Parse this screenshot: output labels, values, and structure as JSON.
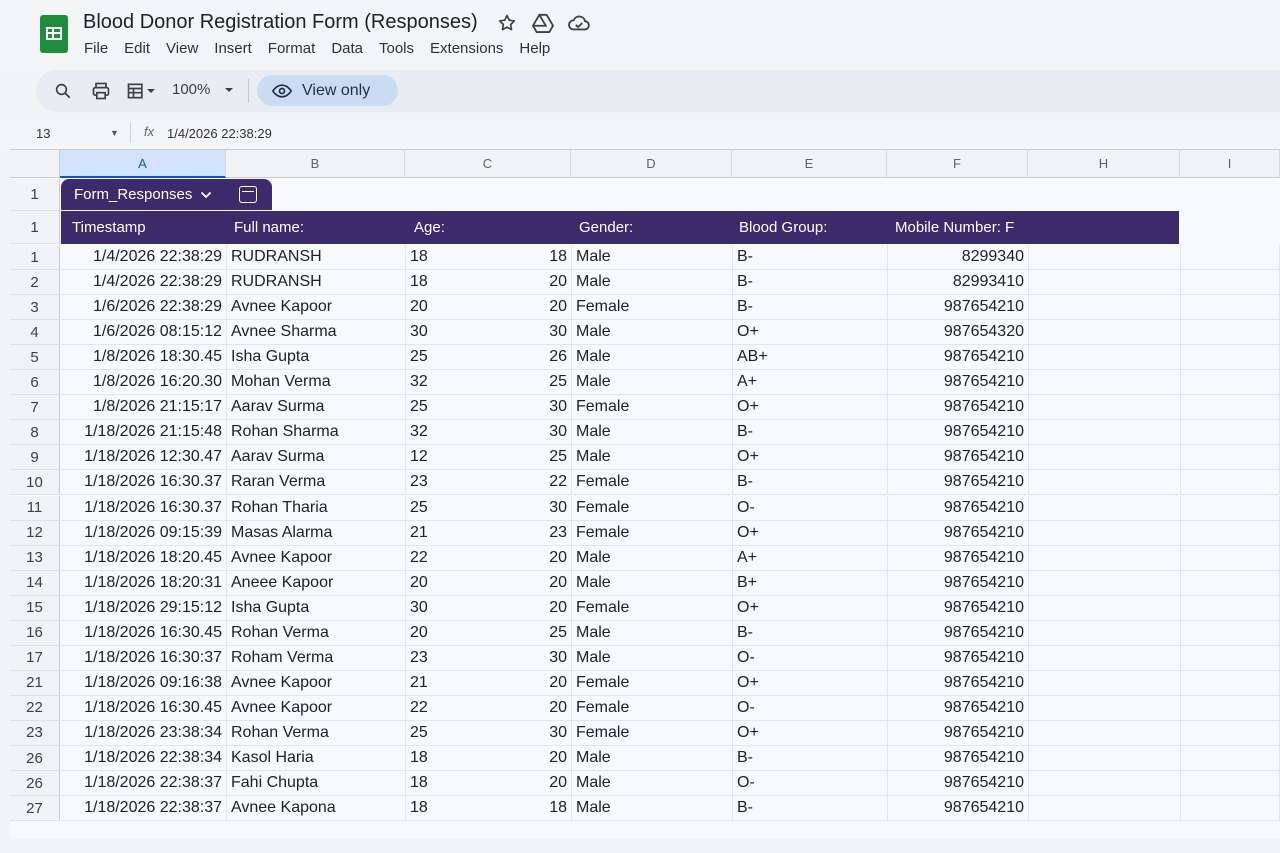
{
  "app": {
    "title": "Blood Donor Registration Form (Responses)",
    "menu": [
      "File",
      "Edit",
      "View",
      "Insert",
      "Format",
      "Data",
      "Tools",
      "Extensions",
      "Help"
    ],
    "icons": [
      "star-icon",
      "move-to-drive-icon",
      "cloud-status-icon"
    ]
  },
  "toolbar": {
    "zoom": "100%",
    "view_only_label": "View only"
  },
  "formula_bar": {
    "cell_ref": "13",
    "fx_symbol": "fx",
    "value": "1/4/2026 22:38:29"
  },
  "grid": {
    "columns": [
      "A",
      "B",
      "C",
      "D",
      "E",
      "F",
      "H",
      "I"
    ],
    "table_tab": {
      "label": "Form_Responses",
      "row_number": "1"
    },
    "header_row_number": "1",
    "headers": [
      "Timestamp",
      "Full name:",
      "Age:",
      "Gender:",
      "Blood Group:",
      "Mobile Number: F"
    ],
    "rows": [
      {
        "n": "1",
        "ts": "1/4/2026 22:38:29",
        "name": "RUDRANSH",
        "age_a": "18",
        "age_b": "18",
        "gender": "Male",
        "blood": "B-",
        "mobile": "8299340"
      },
      {
        "n": "2",
        "ts": "1/4/2026 22:38:29",
        "name": "RUDRANSH",
        "age_a": "18",
        "age_b": "20",
        "gender": "Male",
        "blood": "B-",
        "mobile": "82993410"
      },
      {
        "n": "3",
        "ts": "1/6/2026 22:38:29",
        "name": "Avnee Kapoor",
        "age_a": "20",
        "age_b": "20",
        "gender": "Female",
        "blood": "B-",
        "mobile": "987654210"
      },
      {
        "n": "4",
        "ts": "1/6/2026 08:15:12",
        "name": "Avnee Sharma",
        "age_a": "30",
        "age_b": "30",
        "gender": "Male",
        "blood": "O+",
        "mobile": "987654320"
      },
      {
        "n": "5",
        "ts": "1/8/2026 18:30.45",
        "name": "Isha Gupta",
        "age_a": "25",
        "age_b": "26",
        "gender": "Male",
        "blood": "AB+",
        "mobile": "987654210"
      },
      {
        "n": "6",
        "ts": "1/8/2026 16:20.30",
        "name": "Mohan Verma",
        "age_a": "32",
        "age_b": "25",
        "gender": "Male",
        "blood": "A+",
        "mobile": "987654210"
      },
      {
        "n": "7",
        "ts": "1/8/2026 21:15:17",
        "name": "Aarav Surma",
        "age_a": "25",
        "age_b": "30",
        "gender": "Female",
        "blood": "O+",
        "mobile": "987654210"
      },
      {
        "n": "8",
        "ts": "1/18/2026 21:15:48",
        "name": "Rohan Sharma",
        "age_a": "32",
        "age_b": "30",
        "gender": "Male",
        "blood": "B-",
        "mobile": "987654210"
      },
      {
        "n": "9",
        "ts": "1/18/2026 12:30.47",
        "name": "Aarav Surma",
        "age_a": "12",
        "age_b": "25",
        "gender": "Male",
        "blood": "O+",
        "mobile": "987654210"
      },
      {
        "n": "10",
        "ts": "1/18/2026 16:30.37",
        "name": "Raran Verma",
        "age_a": "23",
        "age_b": "22",
        "gender": "Female",
        "blood": "B-",
        "mobile": "987654210"
      },
      {
        "n": "11",
        "ts": "1/18/2026 16:30.37",
        "name": "Rohan Tharia",
        "age_a": "25",
        "age_b": "30",
        "gender": "Female",
        "blood": "O-",
        "mobile": "987654210"
      },
      {
        "n": "12",
        "ts": "1/18/2026 09:15:39",
        "name": "Masas Alarma",
        "age_a": "21",
        "age_b": "23",
        "gender": "Female",
        "blood": "O+",
        "mobile": "987654210"
      },
      {
        "n": "13",
        "ts": "1/18/2026 18:20.45",
        "name": "Avnee Kapoor",
        "age_a": "22",
        "age_b": "20",
        "gender": "Male",
        "blood": "A+",
        "mobile": "987654210"
      },
      {
        "n": "14",
        "ts": "1/18/2026 18:20:31",
        "name": "Aneee Kapoor",
        "age_a": "20",
        "age_b": "20",
        "gender": "Male",
        "blood": "B+",
        "mobile": "987654210"
      },
      {
        "n": "15",
        "ts": "1/18/2026 29:15:12",
        "name": "Isha Gupta",
        "age_a": "30",
        "age_b": "20",
        "gender": "Female",
        "blood": "O+",
        "mobile": "987654210"
      },
      {
        "n": "16",
        "ts": "1/18/2026 16:30.45",
        "name": "Rohan Verma",
        "age_a": "20",
        "age_b": "25",
        "gender": "Male",
        "blood": "B-",
        "mobile": "987654210"
      },
      {
        "n": "17",
        "ts": "1/18/2026 16:30:37",
        "name": "Roham Verma",
        "age_a": "23",
        "age_b": "30",
        "gender": "Male",
        "blood": "O-",
        "mobile": "987654210"
      },
      {
        "n": "21",
        "ts": "1/18/2026 09:16:38",
        "name": "Avnee Kapoor",
        "age_a": "21",
        "age_b": "20",
        "gender": "Female",
        "blood": "O+",
        "mobile": "987654210"
      },
      {
        "n": "22",
        "ts": "1/18/2026 16:30.45",
        "name": "Avnee Kapoor",
        "age_a": "22",
        "age_b": "20",
        "gender": "Female",
        "blood": "O-",
        "mobile": "987654210"
      },
      {
        "n": "23",
        "ts": "1/18/2026 23:38:34",
        "name": "Rohan Verma",
        "age_a": "25",
        "age_b": "30",
        "gender": "Female",
        "blood": "O+",
        "mobile": "987654210"
      },
      {
        "n": "26",
        "ts": "1/18/2026 22:38:34",
        "name": "Kasol Haria",
        "age_a": "18",
        "age_b": "20",
        "gender": "Male",
        "blood": "B-",
        "mobile": "987654210"
      },
      {
        "n": "26",
        "ts": "1/18/2026 22:38:37",
        "name": "Fahi Chupta",
        "age_a": "18",
        "age_b": "20",
        "gender": "Male",
        "blood": "O-",
        "mobile": "987654210"
      },
      {
        "n": "27",
        "ts": "1/18/2026 22:38:37",
        "name": "Avnee Kapona",
        "age_a": "18",
        "age_b": "18",
        "gender": "Male",
        "blood": "B-",
        "mobile": "987654210"
      }
    ]
  },
  "colors": {
    "accent": "#3d2a6b",
    "view_only_bg": "#c9dcf2",
    "logo": "#1e8e3e"
  }
}
